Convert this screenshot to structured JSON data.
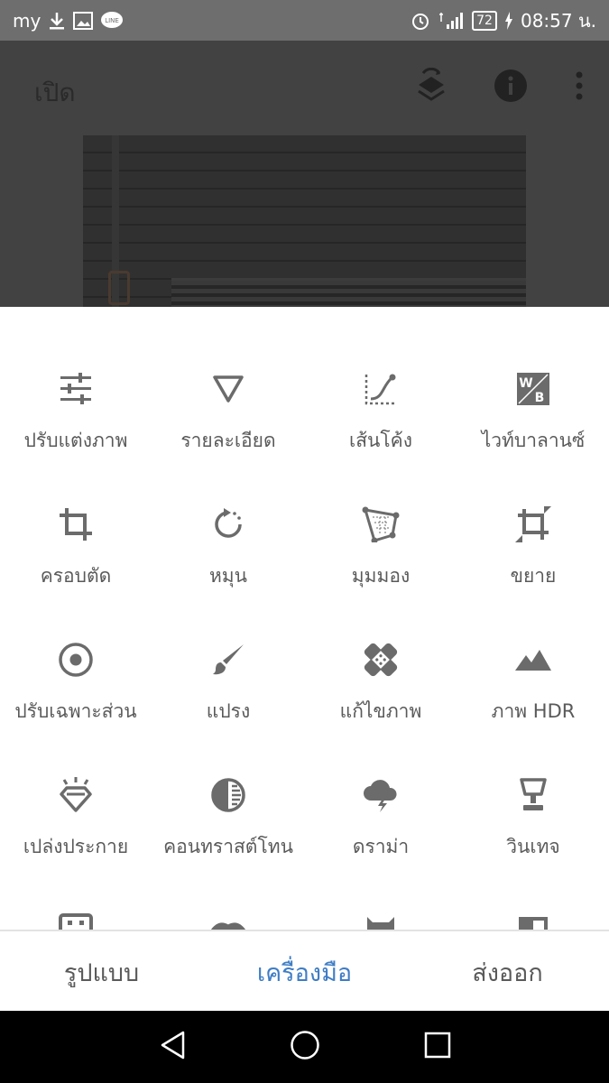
{
  "status_bar": {
    "carrier": "my",
    "line_badge": "LINE",
    "battery": "72",
    "time": "08:57 น.",
    "icons": [
      "download-icon",
      "image-alert-icon",
      "line-icon",
      "alarm-icon",
      "signal-icon",
      "battery-icon",
      "charging-icon"
    ]
  },
  "app_bar": {
    "title": "เปิด",
    "icons": [
      "layers-icon",
      "info-icon",
      "more-vert-icon"
    ]
  },
  "tools": [
    {
      "label": "ปรับแต่งภาพ",
      "icon": "tune-sliders-icon"
    },
    {
      "label": "รายละเอียด",
      "icon": "details-triangle-icon"
    },
    {
      "label": "เส้นโค้ง",
      "icon": "curves-icon"
    },
    {
      "label": "ไวท์บาลานซ์",
      "icon": "white-balance-icon"
    },
    {
      "label": "ครอบตัด",
      "icon": "crop-icon"
    },
    {
      "label": "หมุน",
      "icon": "rotate-icon"
    },
    {
      "label": "มุมมอง",
      "icon": "perspective-icon"
    },
    {
      "label": "ขยาย",
      "icon": "expand-icon"
    },
    {
      "label": "ปรับเฉพาะส่วน",
      "icon": "selective-icon"
    },
    {
      "label": "แปรง",
      "icon": "brush-icon"
    },
    {
      "label": "แก้ไขภาพ",
      "icon": "healing-icon"
    },
    {
      "label": "ภาพ HDR",
      "icon": "hdr-mountain-icon"
    },
    {
      "label": "เปล่งประกาย",
      "icon": "glamour-glow-icon"
    },
    {
      "label": "คอนทราสต์โทน",
      "icon": "tonal-contrast-icon"
    },
    {
      "label": "ดราม่า",
      "icon": "drama-cloud-icon"
    },
    {
      "label": "วินเทจ",
      "icon": "vintage-lamp-icon"
    }
  ],
  "bottom_tabs": [
    {
      "label": "รูปแบบ",
      "active": false
    },
    {
      "label": "เครื่องมือ",
      "active": true
    },
    {
      "label": "ส่งออก",
      "active": false
    }
  ],
  "colors": {
    "accent": "#3f7dc5",
    "icon": "#6b6b6b",
    "text": "#5a5a5a",
    "scrim": "#424242"
  },
  "nav_bar": [
    "back-icon",
    "home-icon",
    "recents-icon"
  ]
}
